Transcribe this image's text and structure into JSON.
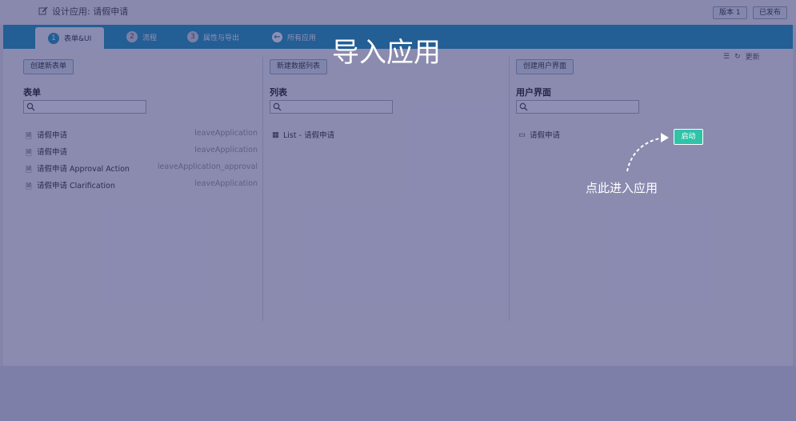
{
  "header": {
    "title": "设计应用: 请假申请",
    "version_button": "版本 1",
    "published_button": "已发布"
  },
  "tabs": [
    {
      "num": "1",
      "label": "表单&UI"
    },
    {
      "num": "2",
      "label": "流程"
    },
    {
      "num": "3",
      "label": "属性与导出"
    },
    {
      "label": "所有应用"
    }
  ],
  "toolbar": {
    "refresh_label": "更新"
  },
  "columns": {
    "forms": {
      "create_button": "创建新表单",
      "heading": "表单",
      "items": [
        {
          "name": "请假申请",
          "id": "leaveApplication"
        },
        {
          "name": "请假申请",
          "id": "leaveApplication"
        },
        {
          "name": "请假申请 Approval Action",
          "id": "leaveApplication_approval"
        },
        {
          "name": "请假申请 Clarification",
          "id": "leaveApplication"
        }
      ]
    },
    "lists": {
      "create_button": "新建数据列表",
      "heading": "列表",
      "items": [
        {
          "name": "List - 请假申请"
        }
      ]
    },
    "uis": {
      "create_button": "创建用户界面",
      "heading": "用户界面",
      "items": [
        {
          "name": "请假申请",
          "launch": "启动"
        }
      ]
    }
  },
  "overlay": {
    "title": "导入应用",
    "hint": "点此进入应用"
  },
  "colors": {
    "accent": "#1e99c0",
    "launch": "#2fc3a8",
    "overlay": "#28286e"
  }
}
